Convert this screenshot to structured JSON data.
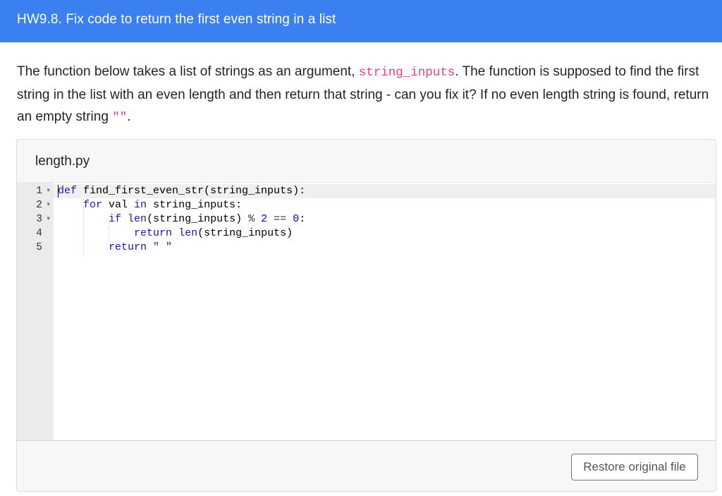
{
  "header": {
    "title": "HW9.8. Fix code to return the first even string in a list"
  },
  "prompt": {
    "part1": "The function below takes a list of strings as an argument, ",
    "code_var": "string_inputs",
    "part2": ". The function is supposed to find the first string in the list with an even length and then return that string - can you fix it? If no even length string is found, return an empty string ",
    "code_empty": "\"\"",
    "part3": "."
  },
  "editor": {
    "file_name": "length.py",
    "line_numbers": [
      "1",
      "2",
      "3",
      "4",
      "5"
    ],
    "lines": [
      {
        "indent": "",
        "tokens": [
          [
            "kw",
            "def"
          ],
          [
            "plain",
            " find_first_even_str(string_inputs):"
          ]
        ]
      },
      {
        "indent": "    ",
        "tokens": [
          [
            "kw",
            "for"
          ],
          [
            "plain",
            " val "
          ],
          [
            "kw",
            "in"
          ],
          [
            "plain",
            " string_inputs:"
          ]
        ]
      },
      {
        "indent": "        ",
        "tokens": [
          [
            "kw",
            "if"
          ],
          [
            "plain",
            " "
          ],
          [
            "kw",
            "len"
          ],
          [
            "plain",
            "(string_inputs) "
          ],
          [
            "op",
            "%"
          ],
          [
            "plain",
            " "
          ],
          [
            "num",
            "2"
          ],
          [
            "plain",
            " "
          ],
          [
            "op",
            "=="
          ],
          [
            "plain",
            " "
          ],
          [
            "num",
            "0"
          ],
          [
            "plain",
            ":"
          ]
        ]
      },
      {
        "indent": "            ",
        "tokens": [
          [
            "kw",
            "return"
          ],
          [
            "plain",
            " "
          ],
          [
            "kw",
            "len"
          ],
          [
            "plain",
            "(string_inputs)"
          ]
        ]
      },
      {
        "indent": "        ",
        "tokens": [
          [
            "kw",
            "return"
          ],
          [
            "plain",
            " "
          ],
          [
            "str",
            "\" \""
          ]
        ]
      }
    ],
    "fold_markers": [
      true,
      true,
      true,
      false,
      false
    ],
    "fold_icon": "triangle-down-icon"
  },
  "actions": {
    "restore_label": "Restore original file"
  }
}
